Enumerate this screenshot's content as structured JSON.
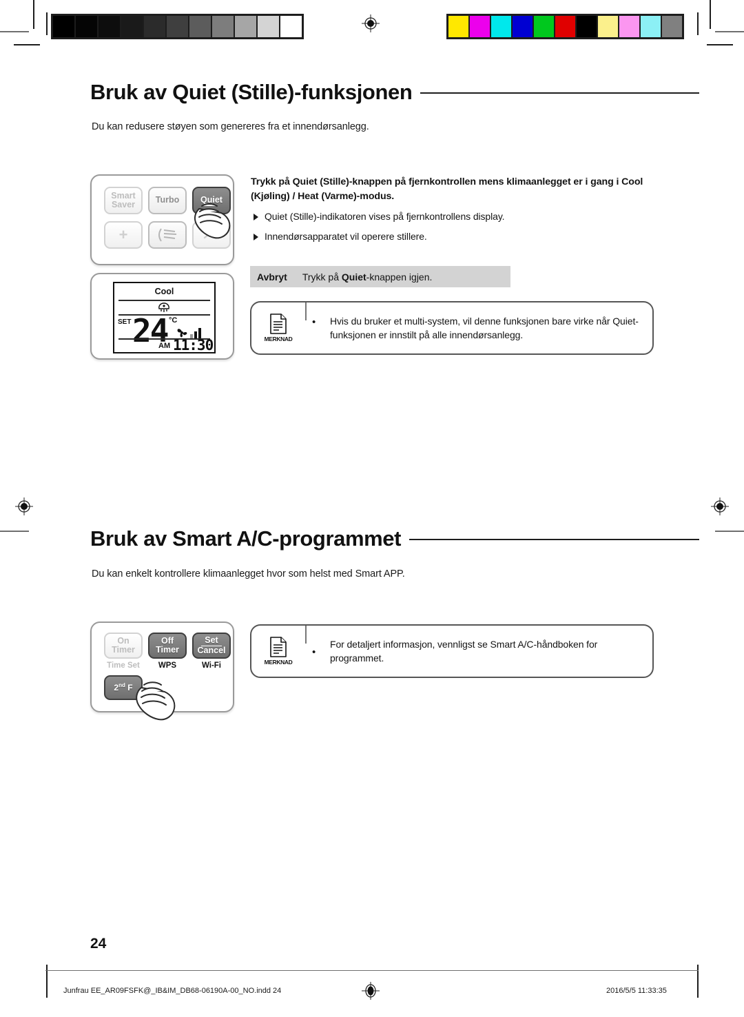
{
  "page": {
    "number": "24",
    "footer_file": "Junfrau EE_AR09FSFK@_IB&IM_DB68-06190A-00_NO.indd   24",
    "footer_timestamp": "2016/5/5   11:33:35"
  },
  "calibration": {
    "grayscale_label": "grayscale-step-wedge",
    "grayscale": [
      "#000000",
      "#050505",
      "#0d0d0d",
      "#1a1a1a",
      "#2b2b2b",
      "#3f3f3f",
      "#5c5c5c",
      "#7d7d7d",
      "#a6a6a6",
      "#d4d4d4",
      "#ffffff"
    ],
    "colors": [
      "#ffe800",
      "#ec00ec",
      "#00e8ec",
      "#0000d2",
      "#00c81e",
      "#e00000",
      "#000000",
      "#fbf08c",
      "#fb96f0",
      "#8cf0f5",
      "#808080"
    ]
  },
  "sections": [
    {
      "id": "quiet",
      "title": "Bruk av Quiet (Stille)-funksjonen",
      "lead": "Du kan redusere støyen som genereres fra et innendørsanlegg.",
      "instruction": {
        "head_parts": [
          {
            "t": "Trykk på ",
            "b": false
          },
          {
            "t": "Quiet (Stille)",
            "b": true
          },
          {
            "t": "-knappen på fjernkontrollen mens klimaanlegget er i gang i Cool (Kjøling) / Heat (Varme)-modus.",
            "b": false
          }
        ],
        "bullets": [
          "Quiet (Stille)-indikatoren vises på fjernkontrollens display.",
          "Innendørsapparatet vil operere stillere."
        ]
      },
      "cancel": {
        "label": "Avbryt",
        "parts": [
          {
            "t": "Trykk på ",
            "b": false
          },
          {
            "t": "Quiet",
            "b": true
          },
          {
            "t": "-knappen igjen.",
            "b": false
          }
        ]
      },
      "note": {
        "icon_word": "MERKNAD",
        "bullet": "•",
        "text": "Hvis du bruker et multi-system, vil denne funksjonen bare virke når Quiet-funksjonen er innstilt på alle innendørsanlegg."
      },
      "remote": {
        "buttons": [
          {
            "name": "smart-saver",
            "lines": [
              "Smart",
              "Saver"
            ],
            "style": "light"
          },
          {
            "name": "turbo",
            "lines": [
              "Turbo"
            ],
            "style": "mid"
          },
          {
            "name": "quiet",
            "lines": [
              "Quiet"
            ],
            "style": "dark"
          }
        ],
        "bottom_buttons": [
          {
            "name": "plus",
            "glyph": "+"
          },
          {
            "name": "airflow",
            "glyph": ""
          },
          {
            "name": "chevron-up",
            "glyph": "^"
          }
        ]
      },
      "lcd": {
        "mode": "Cool",
        "set_label": "SET",
        "temperature": "24",
        "unit": "°C",
        "ampm": "AM",
        "time": "11:30",
        "fan_bars": 3
      }
    },
    {
      "id": "smart-ac",
      "title": "Bruk av Smart A/C-programmet",
      "lead": "Du kan enkelt kontrollere klimaanlegget hvor som helst med Smart APP.",
      "note": {
        "icon_word": "MERKNAD",
        "bullet": "•",
        "text": "For detaljert informasjon, vennligst se Smart A/C-håndboken for programmet."
      },
      "remote": {
        "buttons": [
          {
            "name": "on-timer",
            "lines": [
              "On",
              "Timer"
            ],
            "style": "light",
            "sub": "Time Set",
            "sub_style": "light"
          },
          {
            "name": "off-timer",
            "lines": [
              "Off",
              "Timer"
            ],
            "style": "dark",
            "sub": "WPS",
            "sub_style": "dark"
          },
          {
            "name": "set-cancel",
            "lines": [
              "Set",
              "Cancel"
            ],
            "style": "dark",
            "sub": "Wi-Fi",
            "sub_style": "dark",
            "divider": true
          },
          {
            "name": "second-function",
            "lines": [
              "2nd F"
            ],
            "style": "dark"
          }
        ]
      }
    }
  ]
}
